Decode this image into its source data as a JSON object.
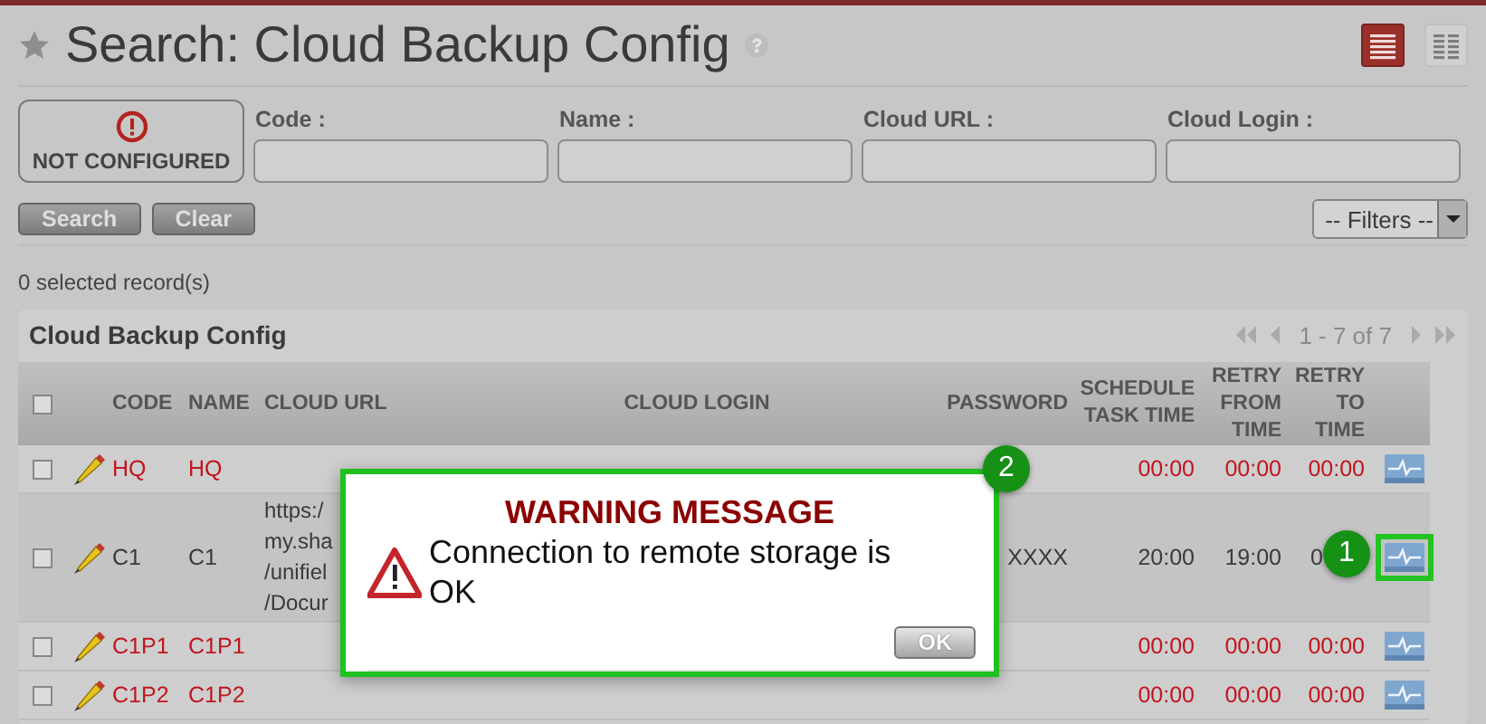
{
  "page": {
    "title": "Search: Cloud Backup Config"
  },
  "view_modes": [
    {
      "kind": "list",
      "selected": true
    },
    {
      "kind": "grid",
      "selected": false
    }
  ],
  "status": {
    "label": "NOT CONFIGURED"
  },
  "search_fields": [
    {
      "label": "Code :"
    },
    {
      "label": "Name :"
    },
    {
      "label": "Cloud URL :"
    },
    {
      "label": "Cloud Login :"
    }
  ],
  "buttons": [
    "Search",
    "Clear"
  ],
  "filters": {
    "value": "-- Filters --"
  },
  "selection_count": "0 selected record(s)",
  "table": {
    "title": "Cloud Backup Config",
    "pager": "1 - 7 of 7",
    "all_checked": false,
    "columns": [
      "CODE",
      "NAME",
      "CLOUD URL",
      "CLOUD LOGIN",
      "PASSWORD",
      "SCHEDULE TASK TIME",
      "RETRY FROM TIME",
      "RETRY TO TIME"
    ],
    "rows": [
      {
        "checked": false,
        "error": true,
        "highlighted": false,
        "code": "HQ",
        "name": "HQ",
        "schedule_task_time": "00:00",
        "retry_from_time": "00:00",
        "retry_to_time": "00:00"
      },
      {
        "checked": false,
        "error": false,
        "highlighted": true,
        "code": "C1",
        "name": "C1",
        "cloud_url": [
          "https:/",
          "my.sha",
          "/unifiel",
          "/Docur"
        ],
        "password": "XXXX",
        "schedule_task_time": "20:00",
        "retry_from_time": "19:00",
        "retry_to_time": "0"
      },
      {
        "checked": false,
        "error": true,
        "highlighted": false,
        "code": "C1P1",
        "name": "C1P1",
        "schedule_task_time": "00:00",
        "retry_from_time": "00:00",
        "retry_to_time": "00:00"
      },
      {
        "checked": false,
        "error": true,
        "highlighted": false,
        "code": "C1P2",
        "name": "C1P2",
        "schedule_task_time": "00:00",
        "retry_from_time": "00:00",
        "retry_to_time": "00:00"
      }
    ]
  },
  "dialog": {
    "title": "WARNING MESSAGE",
    "message": "Connection to remote storage is OK",
    "button": "OK"
  },
  "callouts": [
    {
      "label": "1"
    },
    {
      "label": "2"
    }
  ]
}
